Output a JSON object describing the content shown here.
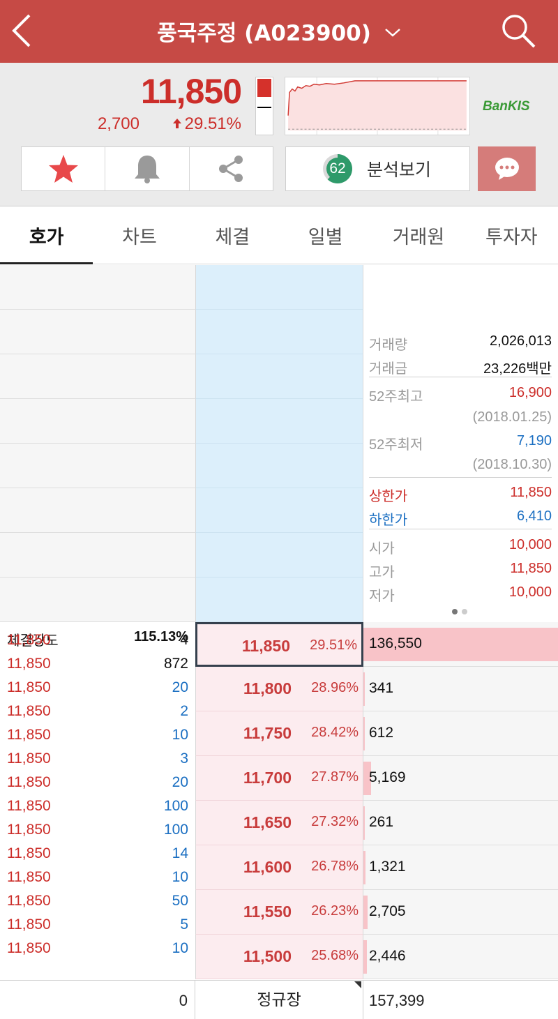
{
  "header": {
    "title": "풍국주정 (A023900)"
  },
  "quote": {
    "price": "11,850",
    "change": "2,700",
    "change_rate": "29.51%",
    "broker_logo": "BanKIS",
    "score": "62",
    "analysis_label": "분석보기",
    "colors": {
      "up": "#cc2e2a",
      "down": "#1b6fc2",
      "header": "#c64a45"
    }
  },
  "tabs": [
    {
      "label": "호가",
      "active": true
    },
    {
      "label": "차트"
    },
    {
      "label": "체결"
    },
    {
      "label": "일별"
    },
    {
      "label": "거래원"
    },
    {
      "label": "투자자"
    }
  ],
  "info": {
    "volume_label": "거래량",
    "volume": "2,026,013",
    "amount_label": "거래금",
    "amount": "23,226백만",
    "high52_label": "52주최고",
    "high52": "16,900",
    "high52_date": "(2018.01.25)",
    "low52_label": "52주최저",
    "low52": "7,190",
    "low52_date": "(2018.10.30)",
    "upper_limit_label": "상한가",
    "upper_limit": "11,850",
    "lower_limit_label": "하한가",
    "lower_limit": "6,410",
    "open_label": "시가",
    "open": "10,000",
    "high_label": "고가",
    "high": "11,850",
    "low_label": "저가",
    "low": "10,000"
  },
  "strength": {
    "label": "체결강도",
    "value": "115.13%"
  },
  "ticks": [
    {
      "price": "11,850",
      "qty": "4",
      "side": "sell"
    },
    {
      "price": "11,850",
      "qty": "872",
      "side": "sell"
    },
    {
      "price": "11,850",
      "qty": "20",
      "side": "buy"
    },
    {
      "price": "11,850",
      "qty": "2",
      "side": "buy"
    },
    {
      "price": "11,850",
      "qty": "10",
      "side": "buy"
    },
    {
      "price": "11,850",
      "qty": "3",
      "side": "buy"
    },
    {
      "price": "11,850",
      "qty": "20",
      "side": "buy"
    },
    {
      "price": "11,850",
      "qty": "100",
      "side": "buy"
    },
    {
      "price": "11,850",
      "qty": "100",
      "side": "buy"
    },
    {
      "price": "11,850",
      "qty": "14",
      "side": "buy"
    },
    {
      "price": "11,850",
      "qty": "10",
      "side": "buy"
    },
    {
      "price": "11,850",
      "qty": "50",
      "side": "buy"
    },
    {
      "price": "11,850",
      "qty": "5",
      "side": "buy"
    },
    {
      "price": "11,850",
      "qty": "10",
      "side": "buy"
    }
  ],
  "bids": [
    {
      "price": "11,850",
      "rate": "29.51%",
      "qty": "136,550",
      "qty_value": 136550,
      "current": true
    },
    {
      "price": "11,800",
      "rate": "28.96%",
      "qty": "341",
      "qty_value": 341
    },
    {
      "price": "11,750",
      "rate": "28.42%",
      "qty": "612",
      "qty_value": 612
    },
    {
      "price": "11,700",
      "rate": "27.87%",
      "qty": "5,169",
      "qty_value": 5169
    },
    {
      "price": "11,650",
      "rate": "27.32%",
      "qty": "261",
      "qty_value": 261
    },
    {
      "price": "11,600",
      "rate": "26.78%",
      "qty": "1,321",
      "qty_value": 1321
    },
    {
      "price": "11,550",
      "rate": "26.23%",
      "qty": "2,705",
      "qty_value": 2705
    },
    {
      "price": "11,500",
      "rate": "25.68%",
      "qty": "2,446",
      "qty_value": 2446
    }
  ],
  "footer": {
    "ask_total": "0",
    "session": "정규장",
    "bid_total": "157,399"
  }
}
